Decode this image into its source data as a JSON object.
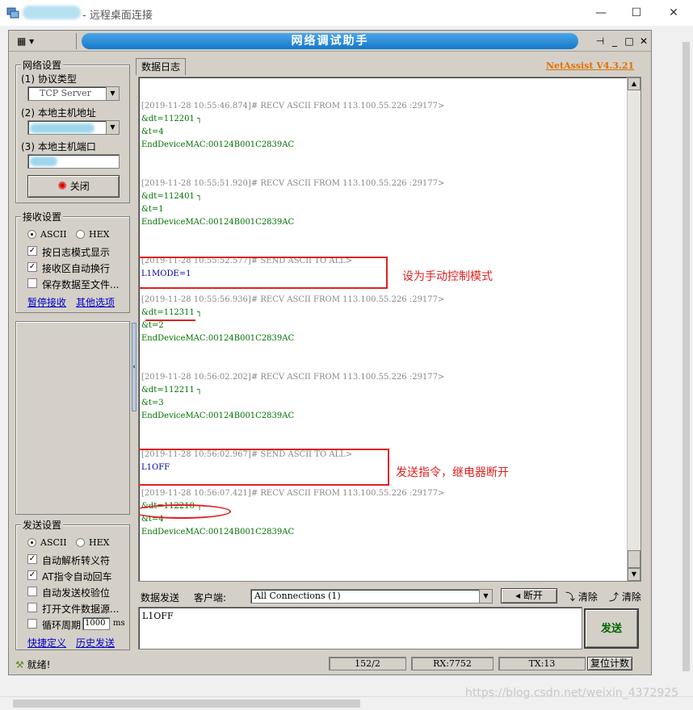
{
  "rdp": {
    "title": "- 远程桌面连接",
    "minimize": "—",
    "maximize": "☐",
    "close": "✕"
  },
  "app": {
    "title": "网络调试助手",
    "menu_icon": "▾",
    "version": "NetAssist V4.3.21"
  },
  "network": {
    "group_title": "网络设置",
    "protocol_label": "(1) 协议类型",
    "protocol_value": "TCP Server",
    "host_label": "(2) 本地主机地址",
    "port_label": "(3) 本地主机端口",
    "close_button": "关闭"
  },
  "receive": {
    "group_title": "接收设置",
    "ascii": "ASCII",
    "hex": "HEX",
    "options": [
      "按日志模式显示",
      "接收区自动换行",
      "保存数据至文件..."
    ],
    "options_checked": [
      true,
      true,
      false
    ],
    "link_clear": "暂停接收",
    "link_more": "其他选项"
  },
  "send": {
    "group_title": "发送设置",
    "ascii": "ASCII",
    "hex": "HEX",
    "options": [
      "自动解析转义符",
      "AT指令自动回车",
      "自动发送校验位",
      "打开文件数据源...",
      "循环周期"
    ],
    "options_checked": [
      true,
      true,
      false,
      false,
      false
    ],
    "period_value": "1000",
    "period_unit": "ms",
    "link_shortcut": "快捷定义",
    "link_history": "历史发送"
  },
  "log": {
    "tab": "数据日志",
    "entries": [
      {
        "head": "[2019-11-28 10:55:46.874]# RECV ASCII FROM 113.100.55.226 :29177>",
        "lines": [
          "&dt=112201      ┐",
          "&t=4",
          "EndDeviceMAC:00124B001C2839AC"
        ],
        "kind": "recv"
      },
      {
        "head": "[2019-11-28 10:55:51.920]# RECV ASCII FROM 113.100.55.226 :29177>",
        "lines": [
          "&dt=112401      ┐",
          "&t=1",
          "EndDeviceMAC:00124B001C2839AC"
        ],
        "kind": "recv"
      },
      {
        "head": "[2019-11-28 10:55:52.577]# SEND ASCII TO ALL>",
        "lines": [
          "L1MODE=1"
        ],
        "kind": "send"
      },
      {
        "head": "[2019-11-28 10:55:56.936]# RECV ASCII FROM 113.100.55.226 :29177>",
        "lines": [
          "&dt=112311      ┐",
          "&t=2",
          "EndDeviceMAC:00124B001C2839AC"
        ],
        "kind": "recv"
      },
      {
        "head": "[2019-11-28 10:56:02.202]# RECV ASCII FROM 113.100.55.226 :29177>",
        "lines": [
          "&dt=112211      ┐",
          "&t=3",
          "EndDeviceMAC:00124B001C2839AC"
        ],
        "kind": "recv"
      },
      {
        "head": "[2019-11-28 10:56:02.967]# SEND ASCII TO ALL>",
        "lines": [
          "L1OFF"
        ],
        "kind": "send"
      },
      {
        "head": "[2019-11-28 10:56:07.421]# RECV ASCII FROM 113.100.55.226 :29177>",
        "lines": [
          "&dt=112210      ┐",
          "&t=4",
          "EndDeviceMAC:00124B001C2839AC"
        ],
        "kind": "recv"
      }
    ],
    "annotation_1": "设为手动控制模式",
    "annotation_2": "发送指令，继电器断开"
  },
  "sendbar": {
    "tab": "数据发送",
    "client_label": "客户端:",
    "client_value": "All Connections (1)",
    "disconnect": "断开",
    "clear1": "清除",
    "clear2": "清除",
    "send_text": "L1OFF",
    "send_button": "发送"
  },
  "status": {
    "ready": "就绪!",
    "counter": "152/2",
    "rx": "RX:7752",
    "tx": "TX:13",
    "reset": "复位计数"
  },
  "watermark": "https://blog.csdn.net/weixin_4372925"
}
